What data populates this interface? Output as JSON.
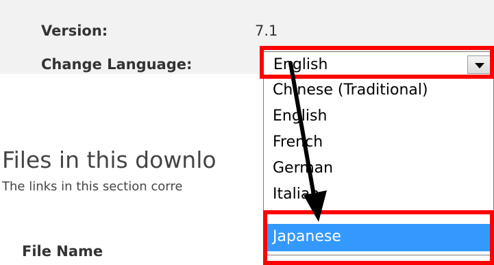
{
  "info": {
    "version_label": "Version:",
    "version_value": "7.1",
    "change_language_label": "Change Language:"
  },
  "language_select": {
    "selected_value": "English",
    "options": [
      {
        "label": "Chinese (Traditional)"
      },
      {
        "label": "English"
      },
      {
        "label": "French"
      },
      {
        "label": "German"
      },
      {
        "label": "Italian"
      },
      {
        "label": "Japanese",
        "highlighted": true
      }
    ]
  },
  "files_section": {
    "heading": "Files in this downlo",
    "description": "The links in this section corre",
    "column_header": "File Name"
  },
  "annotation": {
    "highlight_color": "#ff0000",
    "arrow_color": "#000000",
    "selected_option_color": "#3399ff"
  }
}
